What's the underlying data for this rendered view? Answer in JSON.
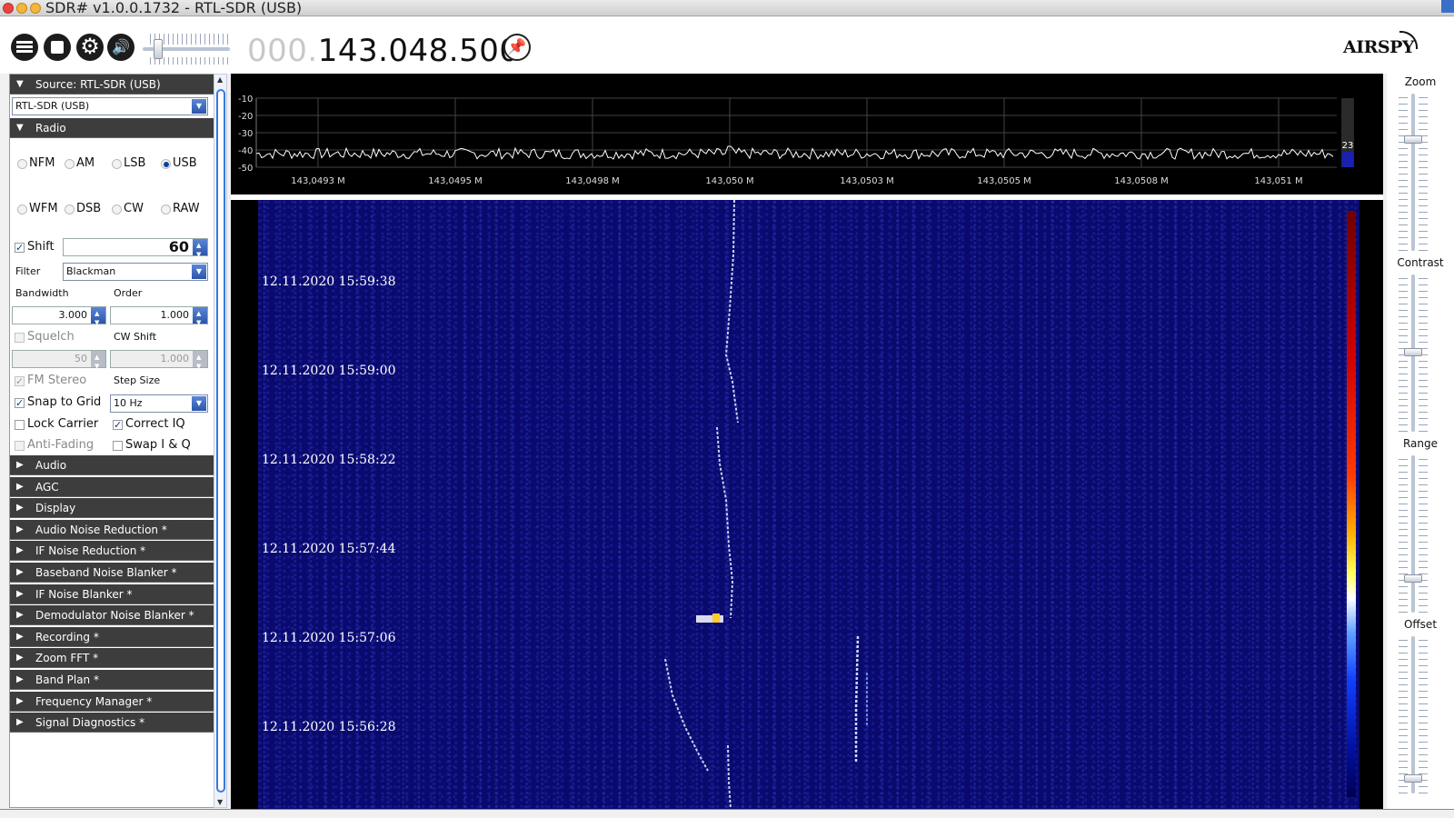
{
  "window": {
    "title": "SDR# v1.0.0.1732 - RTL-SDR (USB)"
  },
  "toolbar": {
    "frequency_dim": "000.",
    "frequency_main": "143.048.500",
    "icons": [
      "menu-icon",
      "stop-icon",
      "gear-icon",
      "speaker-icon",
      "pin-icon"
    ],
    "logo": "AIRSPY"
  },
  "source": {
    "header": "Source: RTL-SDR (USB)",
    "device": "RTL-SDR (USB)"
  },
  "radio": {
    "header": "Radio",
    "modes_row1": [
      {
        "label": "NFM",
        "checked": false
      },
      {
        "label": "AM",
        "checked": false
      },
      {
        "label": "LSB",
        "checked": false
      },
      {
        "label": "USB",
        "checked": true
      }
    ],
    "modes_row2": [
      {
        "label": "WFM",
        "checked": false
      },
      {
        "label": "DSB",
        "checked": false
      },
      {
        "label": "CW",
        "checked": false
      },
      {
        "label": "RAW",
        "checked": false
      }
    ],
    "shift_label": "Shift",
    "shift_value": "60",
    "filter_label": "Filter",
    "filter_value": "Blackman",
    "bandwidth_label": "Bandwidth",
    "bandwidth_value": "3.000",
    "order_label": "Order",
    "order_value": "1.000",
    "squelch_label": "Squelch",
    "squelch_value": "50",
    "cw_shift_label": "CW Shift",
    "cw_shift_value": "1.000",
    "fm_stereo_label": "FM Stereo",
    "step_size_label": "Step Size",
    "snap_label": "Snap to Grid",
    "step_value": "10 Hz",
    "lock_carrier_label": "Lock Carrier",
    "correct_iq_label": "Correct IQ",
    "anti_fading_label": "Anti-Fading",
    "swap_iq_label": "Swap I & Q"
  },
  "collapsed_sections": [
    "Audio",
    "AGC",
    "Display",
    "Audio Noise Reduction *",
    "IF Noise Reduction *",
    "Baseband Noise Blanker *",
    "IF Noise Blanker *",
    "Demodulator Noise Blanker *",
    "Recording *",
    "Zoom FFT *",
    "Band Plan *",
    "Frequency Manager *",
    "Signal Diagnostics *"
  ],
  "spectrum": {
    "y_ticks": [
      "-10",
      "-20",
      "-30",
      "-40",
      "-50"
    ],
    "x_ticks": [
      "143,0493 M",
      "143,0495 M",
      "143,0498 M",
      "143,050 M",
      "143,0503 M",
      "143,0505 M",
      "143,0508 M",
      "143,051 M"
    ],
    "level_readout": "23"
  },
  "waterfall": {
    "timestamps": [
      "12.11.2020 15:59:38",
      "12.11.2020 15:59:00",
      "12.11.2020 15:58:22",
      "12.11.2020 15:57:44",
      "12.11.2020 15:57:06",
      "12.11.2020 15:56:28"
    ]
  },
  "right_panel": {
    "zoom_label": "Zoom",
    "contrast_label": "Contrast",
    "range_label": "Range",
    "offset_label": "Offset"
  },
  "colors": {
    "panel_header": "#3d3d3d",
    "waterfall_background": "#0a0a6e",
    "accent_blue": "#2b55a9"
  }
}
